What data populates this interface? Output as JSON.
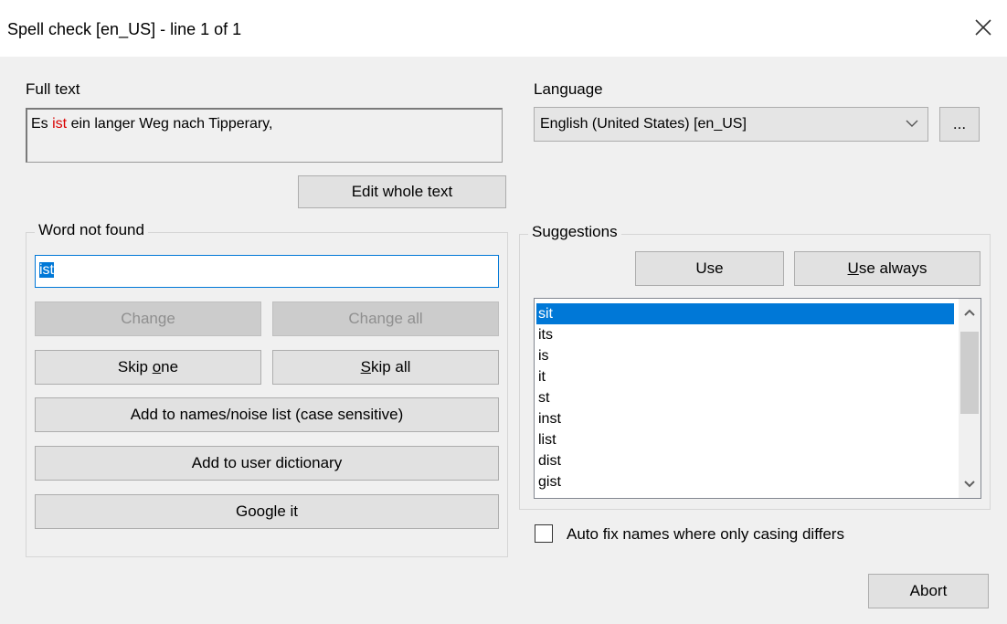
{
  "window": {
    "title": "Spell check [en_US] - line 1 of 1"
  },
  "full_text": {
    "label": "Full text",
    "before": "Es ",
    "misspelled": "ist",
    "after": " ein langer Weg nach Tipperary,",
    "edit_button": "Edit whole text"
  },
  "language": {
    "label": "Language",
    "selected": "English (United States) [en_US]",
    "more_button": "..."
  },
  "word_not_found": {
    "label": "Word not found",
    "value": "ist",
    "change": "Change",
    "change_all": "Change all",
    "skip_one": {
      "pre": "Skip ",
      "accel": "o",
      "post": "ne"
    },
    "skip_all": {
      "accel": "S",
      "post": "kip all"
    },
    "add_names": "Add to names/noise list (case sensitive)",
    "add_user_dict": "Add to user dictionary",
    "google": "Google it"
  },
  "suggestions": {
    "label": "Suggestions",
    "use": "Use",
    "use_always": {
      "accel": "U",
      "post": "se always"
    },
    "items": [
      "sit",
      "its",
      "is",
      "it",
      "st",
      "inst",
      "list",
      "dist",
      "gist"
    ],
    "selected_index": 0
  },
  "auto_fix": {
    "label": "Auto fix names where only casing differs",
    "checked": false
  },
  "abort": "Abort"
}
